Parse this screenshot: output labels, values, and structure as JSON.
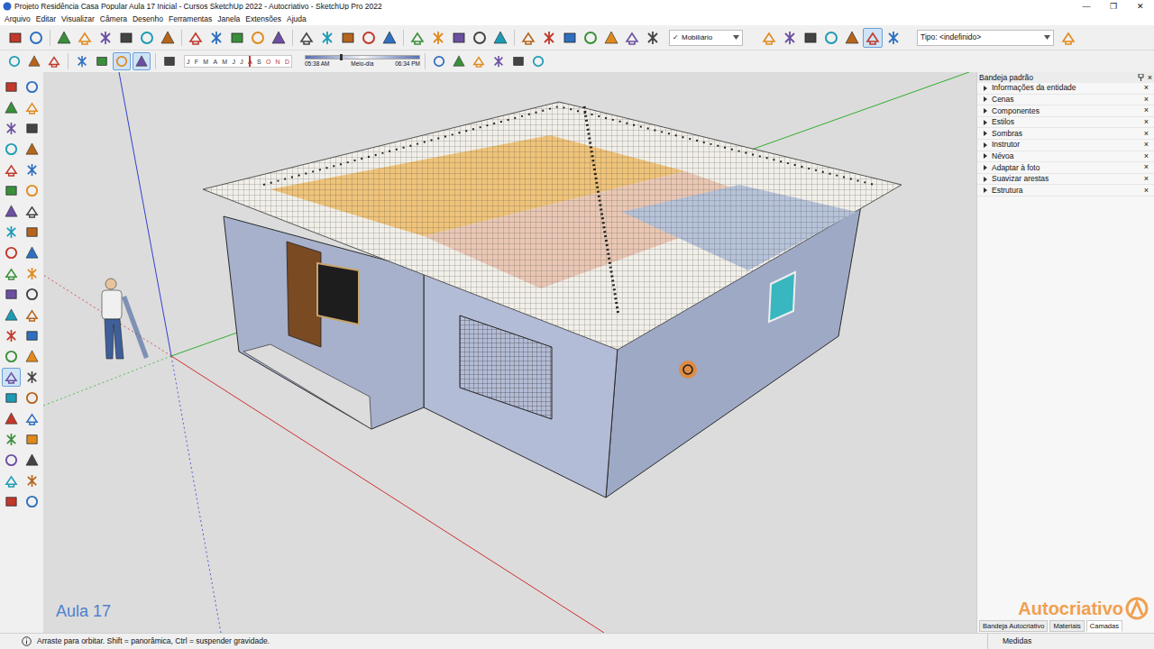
{
  "window": {
    "title": "Projeto Residência Casa Popular Aula 17 Inicial - Cursos SketchUp 2022 - Autocriativo - SketchUp Pro 2022",
    "controls": [
      "—",
      "❐",
      "✕"
    ]
  },
  "menu": [
    "Arquivo",
    "Editar",
    "Visualizar",
    "Câmera",
    "Desenho",
    "Ferramentas",
    "Janela",
    "Extensões",
    "Ajuda"
  ],
  "toolbar_top": {
    "icons_left": [
      {
        "pressed": false
      },
      {
        "pressed": false
      },
      {
        "pressed": false
      },
      {
        "pressed": false
      },
      {
        "pressed": false
      },
      {
        "pressed": false
      },
      {
        "pressed": false
      },
      {
        "pressed": false
      },
      {
        "pressed": false
      },
      {
        "pressed": false
      },
      {
        "pressed": false
      },
      {
        "pressed": false
      },
      {
        "pressed": false
      },
      {
        "pressed": false
      },
      {
        "pressed": false
      },
      {
        "pressed": false
      },
      {
        "pressed": false
      },
      {
        "pressed": false
      },
      {
        "pressed": false
      },
      {
        "pressed": false
      },
      {
        "pressed": false
      },
      {
        "pressed": false
      },
      {
        "pressed": false
      },
      {
        "pressed": false
      },
      {
        "pressed": false
      },
      {
        "pressed": false
      },
      {
        "pressed": false
      },
      {
        "pressed": false
      },
      {
        "pressed": false
      },
      {
        "pressed": false
      }
    ],
    "tag_dropdown": {
      "check": "✓",
      "value": "Mobiliário"
    },
    "icons_right": [
      {
        "pressed": false
      },
      {
        "pressed": false
      },
      {
        "pressed": false
      },
      {
        "pressed": false
      },
      {
        "pressed": false
      },
      {
        "pressed": true
      },
      {
        "pressed": false
      }
    ],
    "type_dropdown": {
      "value": "Tipo: <indefinido>"
    }
  },
  "toolbar_second": {
    "icons_left": [
      {
        "pressed": false
      },
      {
        "pressed": false
      },
      {
        "pressed": false
      },
      {
        "pressed": false
      },
      {
        "pressed": false
      },
      {
        "pressed": true
      },
      {
        "pressed": true
      }
    ],
    "shadow": {
      "months": [
        "J",
        "F",
        "M",
        "A",
        "M",
        "J",
        "J",
        "A",
        "S",
        "O",
        "N",
        "D"
      ],
      "month_level": 0.6,
      "start_time": "05:38 AM",
      "mid": "Meio-dia",
      "end_time": "06:34 PM",
      "time_level": 0.3
    },
    "icons_right": [
      {
        "pressed": false
      },
      {
        "pressed": false
      },
      {
        "pressed": false
      },
      {
        "pressed": false
      },
      {
        "pressed": false
      },
      {
        "pressed": false
      }
    ]
  },
  "left_toolbar": [
    {
      "selected": false
    },
    {
      "selected": false
    },
    {
      "selected": false
    },
    {
      "selected": false
    },
    {
      "selected": false
    },
    {
      "selected": false
    },
    {
      "selected": false
    },
    {
      "selected": false
    },
    {
      "selected": false
    },
    {
      "selected": false
    },
    {
      "selected": false
    },
    {
      "selected": false
    },
    {
      "selected": false
    },
    {
      "selected": false
    },
    {
      "selected": false
    },
    {
      "selected": false
    },
    {
      "selected": false
    },
    {
      "selected": false
    },
    {
      "selected": false
    },
    {
      "selected": false
    },
    {
      "selected": false
    },
    {
      "selected": false
    },
    {
      "selected": false
    },
    {
      "selected": false
    },
    {
      "selected": false
    },
    {
      "selected": false
    },
    {
      "selected": false
    },
    {
      "selected": false
    },
    {
      "selected": true
    },
    {
      "selected": false
    },
    {
      "selected": false
    },
    {
      "selected": false
    },
    {
      "selected": false
    },
    {
      "selected": false
    },
    {
      "selected": false
    },
    {
      "selected": false
    },
    {
      "selected": false
    },
    {
      "selected": false
    },
    {
      "selected": false
    },
    {
      "selected": false
    },
    {
      "selected": false
    },
    {
      "selected": false
    }
  ],
  "viewport": {
    "label": "Aula 17"
  },
  "tray": {
    "title": "Bandeja padrão",
    "close_glyph": "×",
    "items": [
      {
        "label": "Informações da entidade",
        "expanded": false
      },
      {
        "label": "Cenas",
        "expanded": false
      },
      {
        "label": "Componentes",
        "expanded": false
      },
      {
        "label": "Estilos",
        "expanded": false
      },
      {
        "label": "Sombras",
        "expanded": false
      },
      {
        "label": "Instrutor",
        "expanded": false
      },
      {
        "label": "Névoa",
        "expanded": false
      },
      {
        "label": "Adaptar à foto",
        "expanded": false
      },
      {
        "label": "Suavizar arestas",
        "expanded": false
      },
      {
        "label": "Estrutura",
        "expanded": false
      }
    ],
    "logo": "Autocriativo",
    "tabs": [
      {
        "label": "Bandeja Autocriativo",
        "selected": false
      },
      {
        "label": "Materiais",
        "selected": false
      },
      {
        "label": "Camadas",
        "selected": true
      }
    ]
  },
  "status_bar": {
    "hint": "Arraste para orbitar. Shift = panorâmica, Ctrl = suspender gravidade.",
    "measurements_label": "Medidas"
  }
}
